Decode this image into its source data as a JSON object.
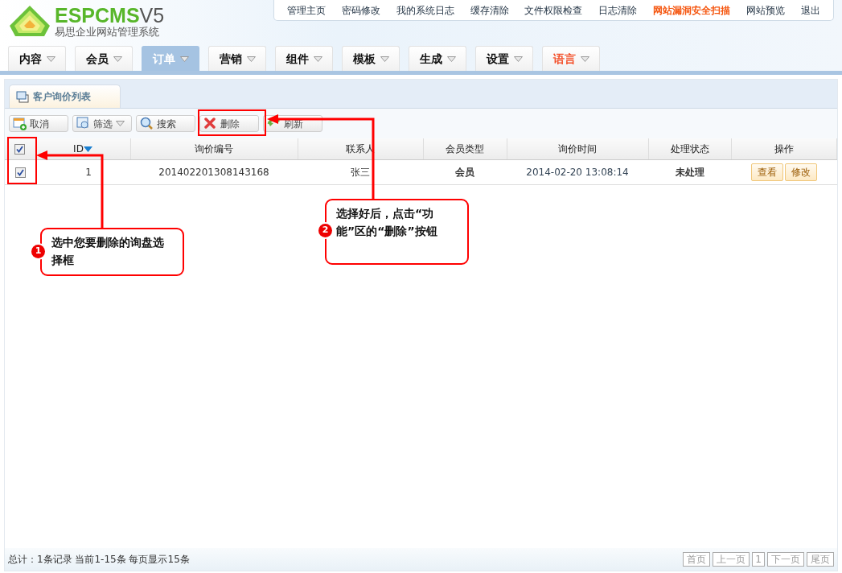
{
  "header": {
    "brand": "ESPCMS",
    "version": "V5",
    "subtitle": "易思企业网站管理系统"
  },
  "top_links": [
    {
      "label": "管理主页",
      "highlighted": false
    },
    {
      "label": "密码修改",
      "highlighted": false
    },
    {
      "label": "我的系统日志",
      "highlighted": false
    },
    {
      "label": "缓存清除",
      "highlighted": false
    },
    {
      "label": "文件权限检查",
      "highlighted": false
    },
    {
      "label": "日志清除",
      "highlighted": false
    },
    {
      "label": "网站漏洞安全扫描",
      "highlighted": true
    },
    {
      "label": "网站预览",
      "highlighted": false
    },
    {
      "label": "退出",
      "highlighted": false
    }
  ],
  "nav_tabs": [
    {
      "label": "内容",
      "selected": false,
      "highlighted": false
    },
    {
      "label": "会员",
      "selected": false,
      "highlighted": false
    },
    {
      "label": "订单",
      "selected": true,
      "highlighted": false
    },
    {
      "label": "营销",
      "selected": false,
      "highlighted": false
    },
    {
      "label": "组件",
      "selected": false,
      "highlighted": false
    },
    {
      "label": "模板",
      "selected": false,
      "highlighted": false
    },
    {
      "label": "生成",
      "selected": false,
      "highlighted": false
    },
    {
      "label": "设置",
      "selected": false,
      "highlighted": false
    },
    {
      "label": "语言",
      "selected": false,
      "highlighted": true
    }
  ],
  "panel_tab": {
    "title": "客户询价列表"
  },
  "toolbar": [
    {
      "label": "取消",
      "kind": "cancel",
      "dropdown": false
    },
    {
      "label": "筛选",
      "kind": "filter",
      "dropdown": true
    },
    {
      "label": "搜索",
      "kind": "search",
      "dropdown": false
    },
    {
      "label": "删除",
      "kind": "delete",
      "dropdown": false
    },
    {
      "label": "刷新",
      "kind": "refresh",
      "dropdown": false
    }
  ],
  "table": {
    "select_all_checked": true,
    "columns": [
      {
        "label": "ID",
        "sorted": true
      },
      {
        "label": "询价编号",
        "sorted": false
      },
      {
        "label": "联系人",
        "sorted": false
      },
      {
        "label": "会员类型",
        "sorted": false
      },
      {
        "label": "询价时间",
        "sorted": false
      },
      {
        "label": "处理状态",
        "sorted": false
      },
      {
        "label": "操作",
        "sorted": false
      }
    ],
    "rows": [
      {
        "checked": true,
        "id": "1",
        "number": "201402201308143168",
        "contact": "张三",
        "member_type": "会员",
        "time": "2014-02-20 13:08:14",
        "status": "未处理",
        "actions": [
          "查看",
          "修改"
        ]
      }
    ]
  },
  "annotations": [
    {
      "badge": "1",
      "text": "选中您要删除的询盘选择框"
    },
    {
      "badge": "2",
      "text": "选择好后，点击“功能”区的“删除”按钮"
    }
  ],
  "footer": {
    "summary": "总计：1条记录 当前1-15条 每页显示15条",
    "pager": [
      {
        "label": "首页",
        "kind": "link"
      },
      {
        "label": "上一页",
        "kind": "link"
      },
      {
        "label": "1",
        "kind": "current"
      },
      {
        "label": "下一页",
        "kind": "link"
      },
      {
        "label": "尾页",
        "kind": "link"
      }
    ]
  }
}
